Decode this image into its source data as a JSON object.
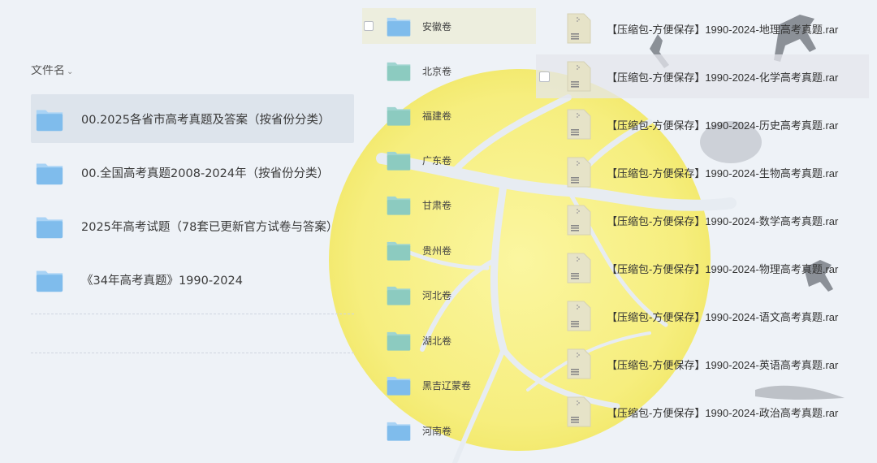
{
  "left": {
    "header": "文件名",
    "folders": [
      {
        "name": "00.2025各省市高考真题及答案（按省份分类）",
        "selected": true
      },
      {
        "name": "00.全国高考真题2008-2024年（按省份分类）",
        "selected": false
      },
      {
        "name": "2025年高考试题（78套已更新官方试卷与答案）",
        "selected": false
      },
      {
        "name": "《34年高考真题》1990-2024",
        "selected": false
      }
    ]
  },
  "middle": {
    "folders": [
      {
        "name": "安徽卷"
      },
      {
        "name": "北京卷"
      },
      {
        "name": "福建卷"
      },
      {
        "name": "广东卷"
      },
      {
        "name": "甘肃卷"
      },
      {
        "name": "贵州卷"
      },
      {
        "name": "河北卷"
      },
      {
        "name": "湖北卷"
      },
      {
        "name": "黑吉辽蒙卷"
      },
      {
        "name": "河南卷"
      }
    ]
  },
  "right": {
    "files": [
      {
        "name": "【压缩包-方便保存】1990-2024-地理高考真题.rar"
      },
      {
        "name": "【压缩包-方便保存】1990-2024-化学高考真题.rar"
      },
      {
        "name": "【压缩包-方便保存】1990-2024-历史高考真题.rar"
      },
      {
        "name": "【压缩包-方便保存】1990-2024-生物高考真题.rar"
      },
      {
        "name": "【压缩包-方便保存】1990-2024-数学高考真题.rar"
      },
      {
        "name": "【压缩包-方便保存】1990-2024-物理高考真题.rar"
      },
      {
        "name": "【压缩包-方便保存】1990-2024-语文高考真题.rar"
      },
      {
        "name": "【压缩包-方便保存】1990-2024-英语高考真题.rar"
      },
      {
        "name": "【压缩包-方便保存】1990-2024-政治高考真题.rar"
      }
    ]
  },
  "colors": {
    "folder_top": "#a9d3f5",
    "folder_body": "#7fbcec",
    "folder_teal_body": "#8ccbc0",
    "moon": "#f7f08a"
  }
}
